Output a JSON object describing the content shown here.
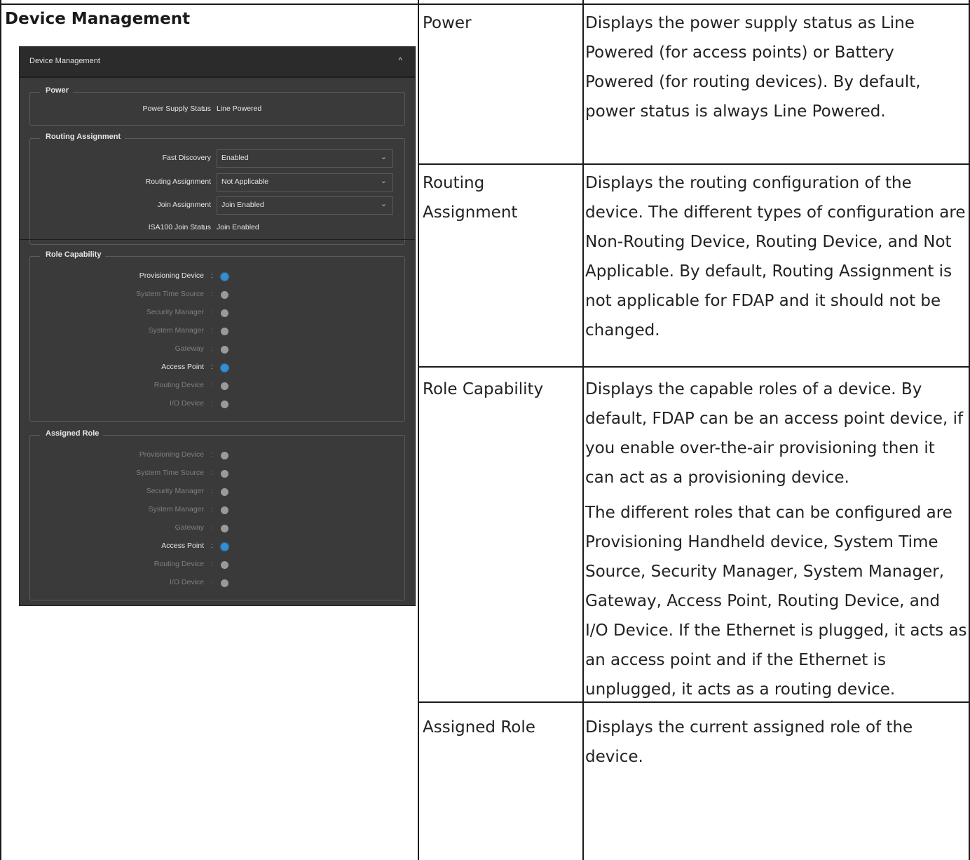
{
  "left_heading": "Device Management",
  "screenshot": {
    "header_title": "Device Management",
    "collapse_glyph": "^",
    "power": {
      "label": "Power",
      "fields": [
        {
          "label": "Power Supply Status",
          "value": "Line Powered"
        }
      ]
    },
    "routing": {
      "label": "Routing Assignment",
      "dropdowns": [
        {
          "label": "Fast Discovery",
          "value": "Enabled"
        },
        {
          "label": "Routing Assignment",
          "value": "Not Applicable"
        },
        {
          "label": "Join Assignment",
          "value": "Join Enabled"
        }
      ],
      "status": {
        "label": "ISA100 Join Status",
        "value": "Join Enabled"
      }
    },
    "role_capability": {
      "label": "Role Capability",
      "items": [
        {
          "label": "Provisioning Device",
          "active": true
        },
        {
          "label": "System Time Source",
          "active": false
        },
        {
          "label": "Security Manager",
          "active": false
        },
        {
          "label": "System Manager",
          "active": false
        },
        {
          "label": "Gateway",
          "active": false
        },
        {
          "label": "Access Point",
          "active": true
        },
        {
          "label": "Routing Device",
          "active": false
        },
        {
          "label": "I/O Device",
          "active": false
        }
      ]
    },
    "assigned_role": {
      "label": "Assigned Role",
      "items": [
        {
          "label": "Provisioning Device",
          "active": false
        },
        {
          "label": "System Time Source",
          "active": false
        },
        {
          "label": "Security Manager",
          "active": false
        },
        {
          "label": "System Manager",
          "active": false
        },
        {
          "label": "Gateway",
          "active": false
        },
        {
          "label": "Access Point",
          "active": true
        },
        {
          "label": "Routing Device",
          "active": false
        },
        {
          "label": "I/O Device",
          "active": false
        }
      ]
    }
  },
  "table": {
    "rows": [
      {
        "term": "Power",
        "description": [
          "Displays the power supply status as Line Powered (for access points) or Battery Powered (for routing devices). By default, power status is always Line Powered."
        ]
      },
      {
        "term": "Routing Assignment",
        "description": [
          "Displays the routing configuration of the device. The different types of configuration are Non-Routing Device, Routing Device, and Not Applicable. By default, Routing Assignment is not applicable for FDAP and it should not be changed."
        ]
      },
      {
        "term": "Role Capability",
        "description": [
          "Displays the capable roles of a device. By default, FDAP can be an access point device, if you enable over-the-air provisioning then it can act as a provisioning device.",
          "The different roles that can be configured are Provisioning Handheld device, System Time Source, Security Manager, System Manager, Gateway, Access Point, Routing Device, and I/O Device. If the Ethernet is plugged, it acts as an access point and if the Ethernet is unplugged, it acts as a routing device."
        ]
      },
      {
        "term": "Assigned Role",
        "description": [
          "Displays the current assigned role of the device."
        ]
      }
    ]
  }
}
